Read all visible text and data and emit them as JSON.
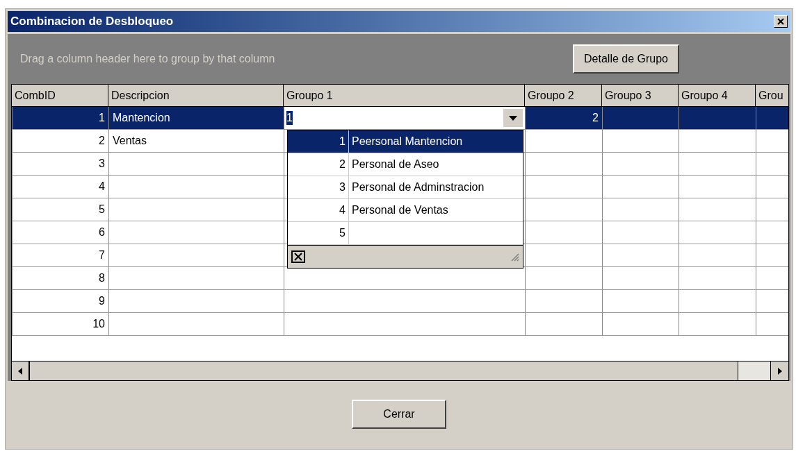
{
  "window": {
    "title": "Combinacion de Desbloqueo"
  },
  "group_area": {
    "hint": "Drag a column header here to group by that column",
    "button": "Detalle de Grupo"
  },
  "grid": {
    "columns": [
      {
        "label": "CombID",
        "kind": "number"
      },
      {
        "label": "Descripcion",
        "kind": "text"
      },
      {
        "label": "Groupo 1",
        "kind": "combo"
      },
      {
        "label": "Groupo 2",
        "kind": "number"
      },
      {
        "label": "Groupo 3",
        "kind": "number"
      },
      {
        "label": "Groupo 4",
        "kind": "number"
      },
      {
        "label": "Grou",
        "kind": "number"
      }
    ],
    "rows": [
      {
        "selected": true,
        "editing": true,
        "cells": [
          "1",
          "Mantencion",
          "1",
          "2"
        ]
      },
      {
        "selected": false,
        "editing": false,
        "cells": [
          "2",
          "Ventas"
        ]
      },
      {
        "selected": false,
        "editing": false,
        "cells": [
          "3"
        ]
      },
      {
        "selected": false,
        "editing": false,
        "cells": [
          "4"
        ]
      },
      {
        "selected": false,
        "editing": false,
        "cells": [
          "5"
        ]
      },
      {
        "selected": false,
        "editing": false,
        "cells": [
          "6"
        ]
      },
      {
        "selected": false,
        "editing": false,
        "cells": [
          "7"
        ]
      },
      {
        "selected": false,
        "editing": false,
        "cells": [
          "8"
        ]
      },
      {
        "selected": false,
        "editing": false,
        "cells": [
          "9"
        ]
      },
      {
        "selected": false,
        "editing": false,
        "cells": [
          "10"
        ]
      }
    ],
    "dropdown": {
      "open": true,
      "items": [
        {
          "id": "1",
          "name": "Peersonal Mantencion",
          "selected": true
        },
        {
          "id": "2",
          "name": "Personal de Aseo",
          "selected": false
        },
        {
          "id": "3",
          "name": "Personal de Adminstracion",
          "selected": false
        },
        {
          "id": "4",
          "name": "Personal de Ventas",
          "selected": false
        },
        {
          "id": "5",
          "selected": false
        }
      ]
    }
  },
  "footer": {
    "button": "Cerrar"
  }
}
